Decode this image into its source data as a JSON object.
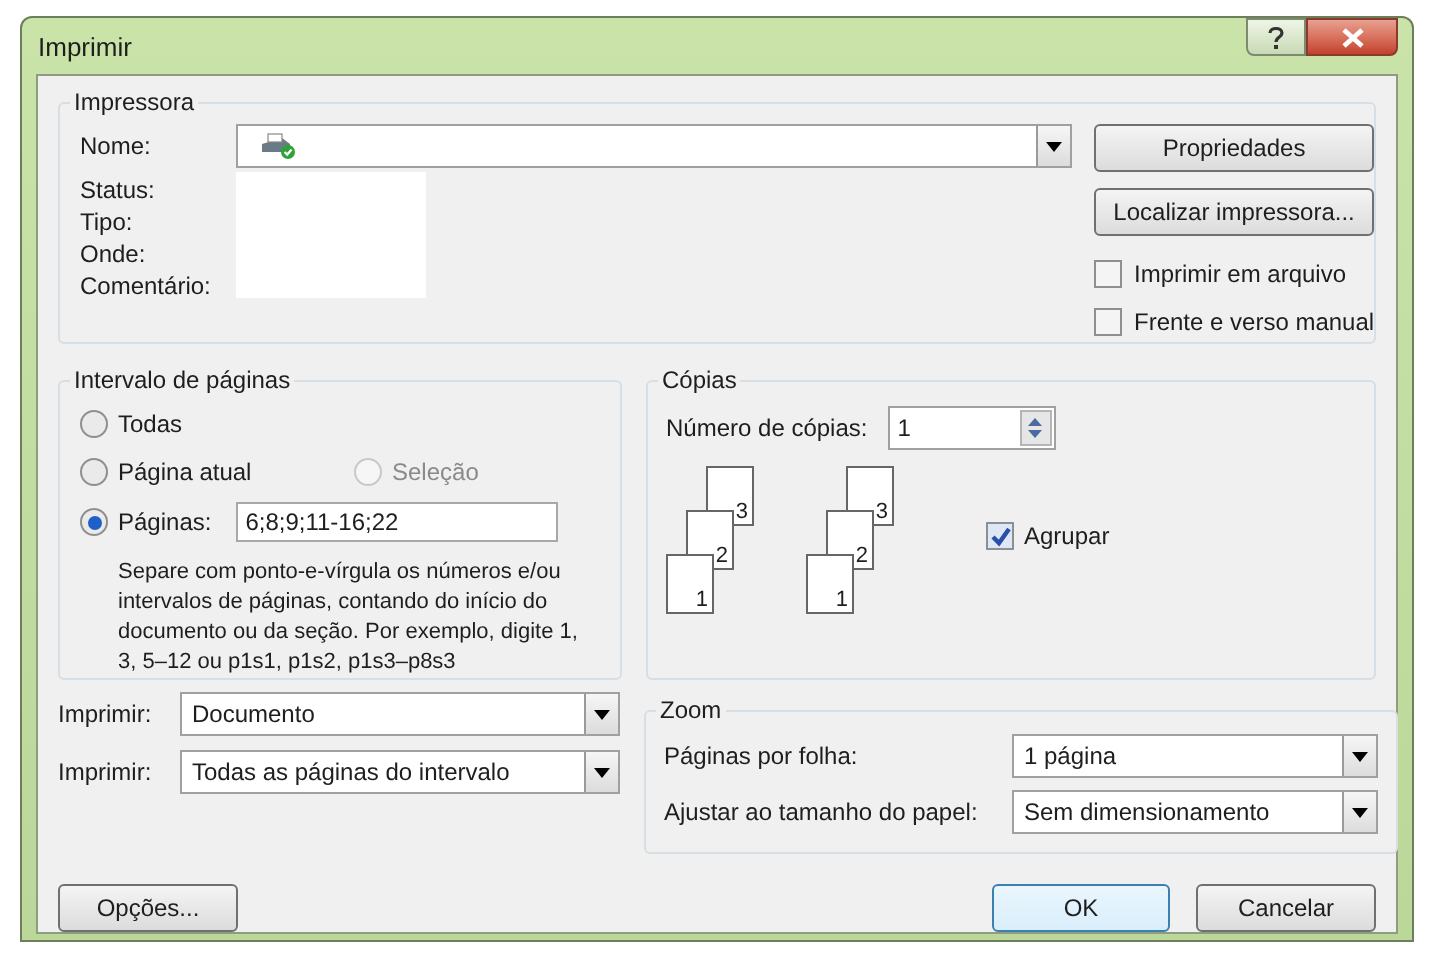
{
  "window": {
    "title": "Imprimir"
  },
  "printer": {
    "label": "Impressora",
    "name_label": "Nome:",
    "properties_button": "Propriedades",
    "find_button": "Localizar impressora...",
    "info_labels": [
      "Status:",
      "Tipo:",
      "Onde:",
      "Comentário:"
    ],
    "options": [
      {
        "label": "Imprimir em arquivo",
        "checked": false
      },
      {
        "label": "Frente e verso manual",
        "checked": false
      }
    ]
  },
  "page_range": {
    "label": "Intervalo de páginas",
    "options": [
      {
        "label": "Todas",
        "selected": false,
        "disabled": false
      },
      {
        "label": "Página atual",
        "selected": false,
        "disabled": false
      },
      {
        "label": "Seleção",
        "selected": false,
        "disabled": true
      },
      {
        "label": "Páginas:",
        "selected": true,
        "disabled": false
      }
    ],
    "pages_value": "6;8;9;11-16;22",
    "hint": "Separe com ponto-e-vírgula os números e/ou intervalos de páginas, contando do início do documento ou da seção. Por exemplo, digite 1, 3, 5–12 ou p1s1, p1s2, p1s3–p8s3"
  },
  "copies": {
    "label": "Cópias",
    "count_label": "Número de cópias:",
    "count_value": "1",
    "stacks": [
      {
        "pages": [
          "1",
          "2",
          "3"
        ]
      },
      {
        "pages": [
          "1",
          "2",
          "3"
        ]
      }
    ],
    "collate": {
      "label": "Agrupar",
      "checked": true
    }
  },
  "print_selects": [
    {
      "label": "Imprimir:",
      "value": "Documento"
    },
    {
      "label": "Imprimir:",
      "value": "Todas as páginas do intervalo"
    }
  ],
  "zoom": {
    "label": "Zoom",
    "rows": [
      {
        "label": "Páginas por folha:",
        "value": "1 página"
      },
      {
        "label": "Ajustar ao tamanho do papel:",
        "value": "Sem dimensionamento"
      }
    ]
  },
  "buttons": {
    "options": "Opções...",
    "ok": "OK",
    "cancel": "Cancelar"
  }
}
